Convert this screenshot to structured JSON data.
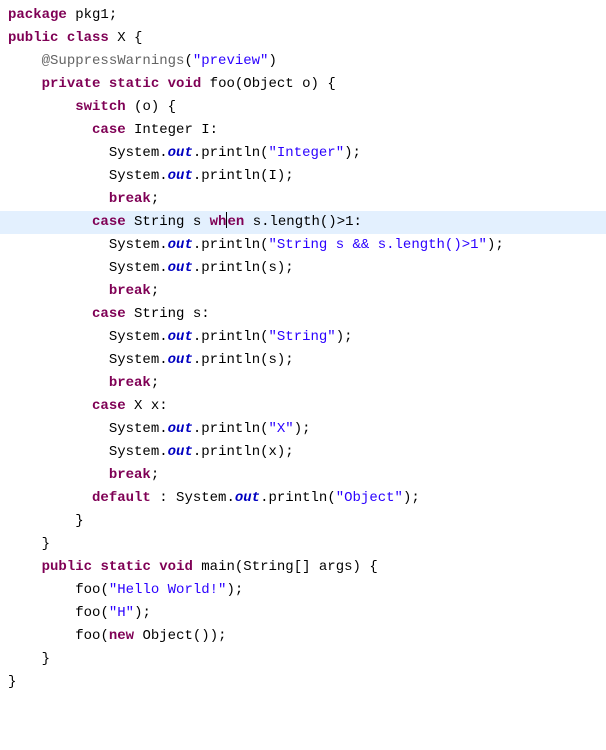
{
  "lines": {
    "l1_package": "package",
    "l1_pkg": "pkg1",
    "l2_public": "public",
    "l2_class": "class",
    "l2_name": "X",
    "l3_ann": "@SuppressWarnings",
    "l3_annarg": "\"preview\"",
    "l4_private": "private",
    "l4_static": "static",
    "l4_void": "void",
    "l4_foo": "foo",
    "l4_param": "Object o",
    "l5_switch": "switch",
    "l5_expr": "o",
    "c_case": "case",
    "c_break": "break",
    "c_default": "default",
    "case_int_label": "Integer I",
    "case_int_str": "\"Integer\"",
    "case_int_var": "I",
    "case_strwhen_left": "String s",
    "case_strwhen_when": "when",
    "case_strwhen_cond": "s.length()>1",
    "case_strwhen_lit": "\"String s && s.length()>1\"",
    "case_strwhen_var": "s",
    "case_str_label": "String s",
    "case_str_lit": "\"String\"",
    "case_str_var": "s",
    "case_x_label": "X x",
    "case_x_lit": "\"X\"",
    "case_x_var": "x",
    "default_lit": "\"Object\"",
    "sys": "System",
    "out": "out",
    "println": "println",
    "main_public": "public",
    "main_static": "static",
    "main_void": "void",
    "main_name": "main",
    "main_args": "String[] args",
    "foo_call": "foo",
    "hello": "\"Hello World!\"",
    "h": "\"H\"",
    "new": "new",
    "object": "Object"
  }
}
